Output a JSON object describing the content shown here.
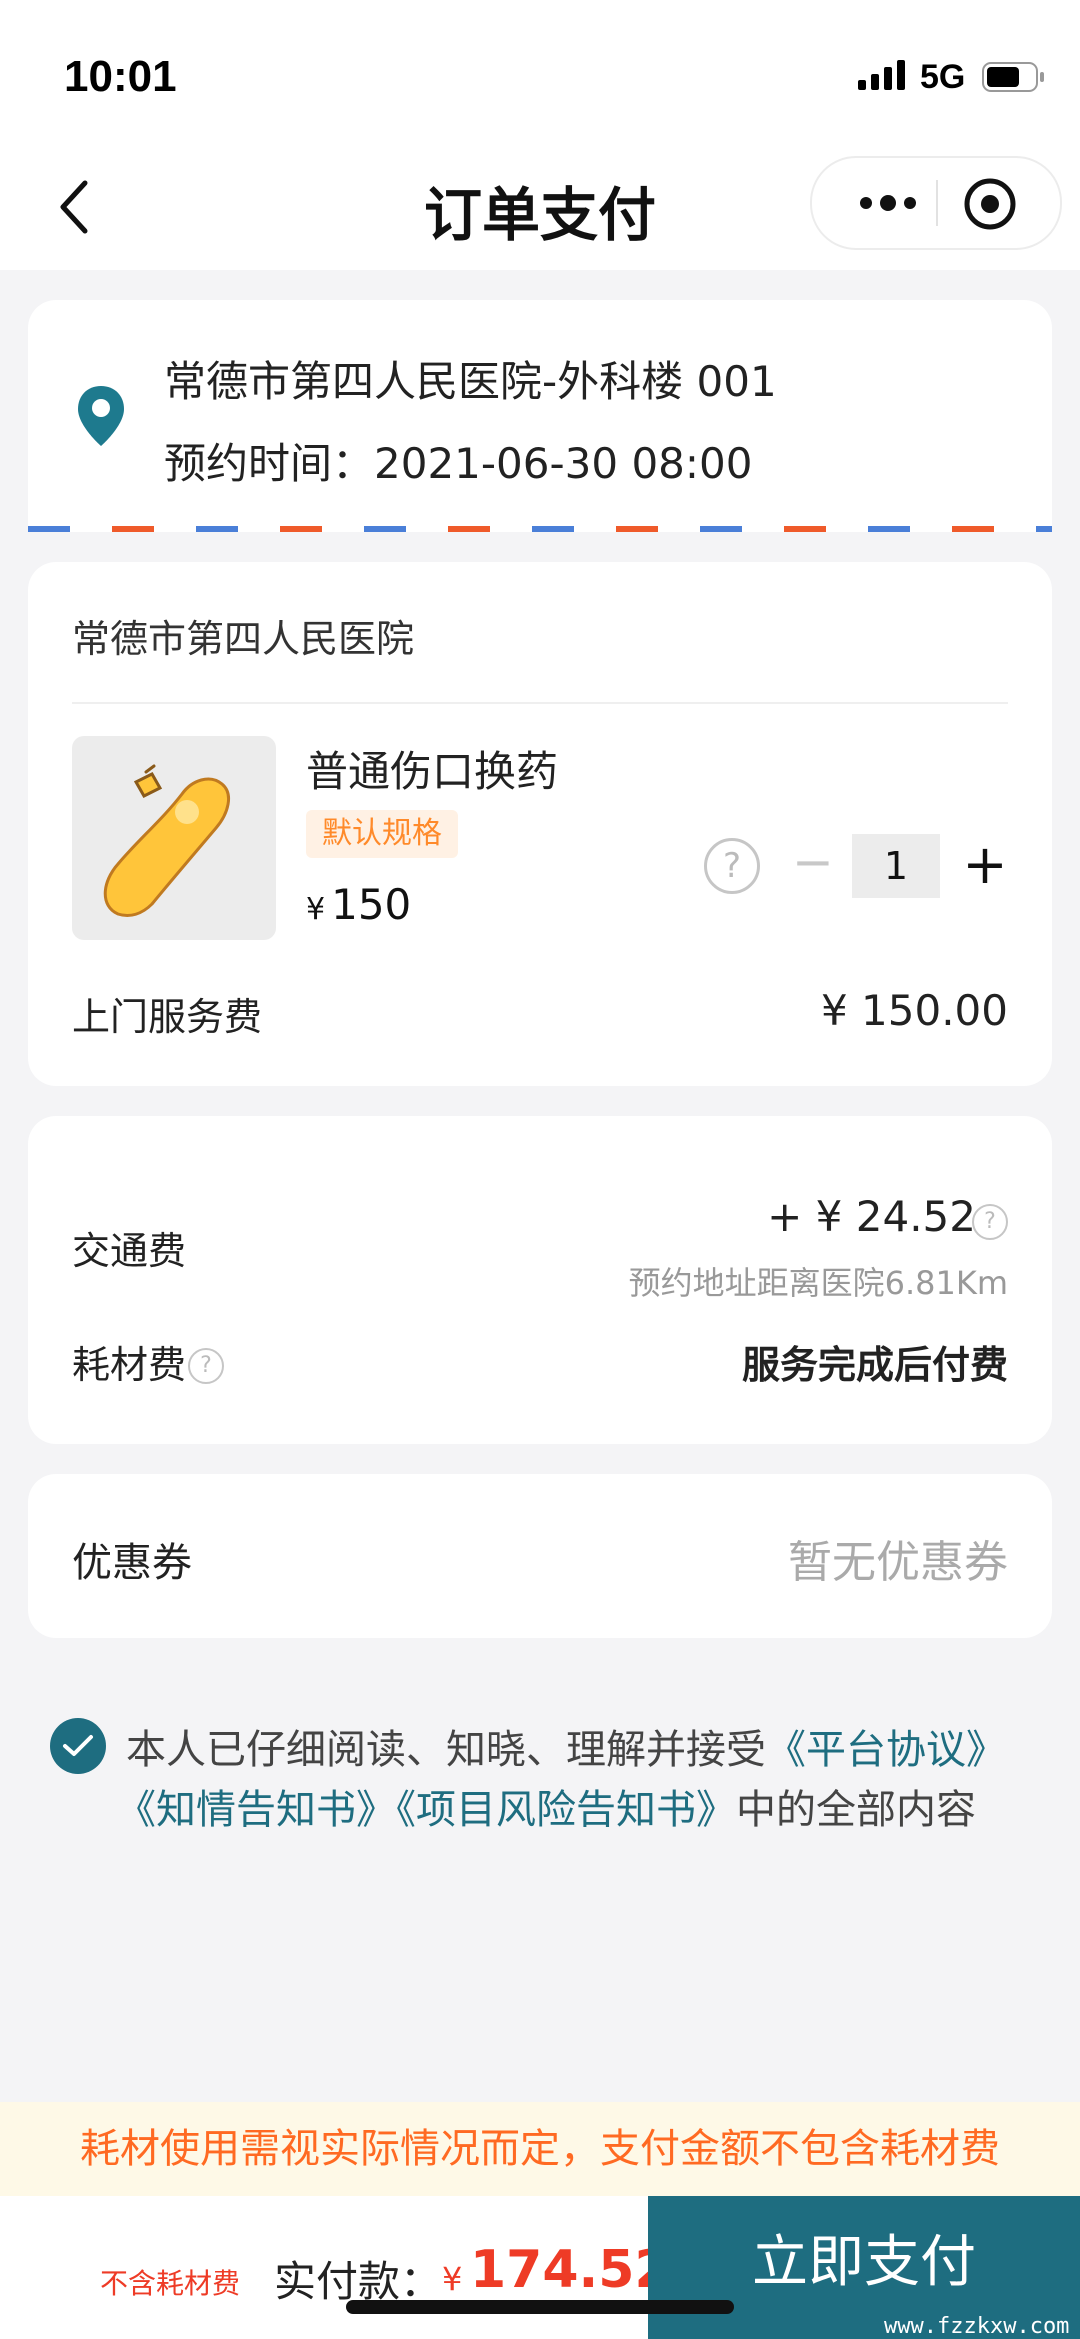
{
  "status_bar": {
    "time": "10:01",
    "network": "5G"
  },
  "nav": {
    "title": "订单支付"
  },
  "address": {
    "name": "常德市第四人民医院-外科楼 001",
    "time_label": "预约时间：",
    "time_value": "2021-06-30 08:00"
  },
  "product": {
    "hospital": "常德市第四人民医院",
    "name": "普通伤口换药",
    "spec": "默认规格",
    "price_symbol": "¥",
    "price": "150",
    "quantity": "1",
    "help": "?",
    "minus": "−",
    "plus": "+",
    "service_fee_label": "上门服务费",
    "service_fee_value": "¥ 150.00"
  },
  "fees": {
    "traffic_label": "交通费",
    "traffic_value": "+ ¥ 24.52",
    "traffic_note": "预约地址距离医院6.81Km",
    "consumable_label": "耗材费",
    "consumable_value": "服务完成后付费",
    "help": "?"
  },
  "coupon": {
    "label": "优惠券",
    "value": "暂无优惠券"
  },
  "agreement": {
    "prefix": "本人已仔细阅读、知晓、理解并接受",
    "link1": "《平台协议》",
    "link2": "《知情告知书》",
    "link3": "《项目风险告知书》",
    "suffix": "中的全部内容"
  },
  "notice": "耗材使用需视实际情况而定，支付金额不包含耗材费",
  "footer": {
    "excluded_note": "不含耗材费",
    "paid_label": "实付款：",
    "currency": "¥",
    "amount": "174.52",
    "pay_button": "立即支付"
  },
  "watermark": "www.fzzkxw.com",
  "colors": {
    "primary": "#1e6d80",
    "accent_red": "#ee3b26",
    "notice_orange": "#ff6a22"
  }
}
